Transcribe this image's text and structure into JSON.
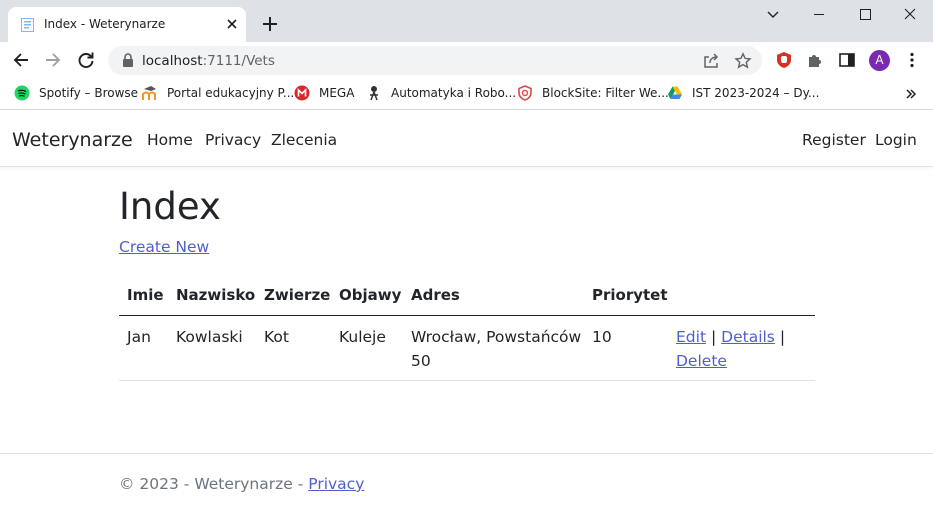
{
  "browser": {
    "tab_title": "Index - Weterynarze",
    "url_host": "localhost",
    "url_path": ":7111/Vets",
    "avatar_letter": "A",
    "bookmarks": [
      {
        "label": "Spotify – Browse",
        "icon": "spotify-icon"
      },
      {
        "label": "Portal edukacyjny P...",
        "icon": "moodle-icon"
      },
      {
        "label": "MEGA",
        "icon": "mega-icon"
      },
      {
        "label": "Automatyka i Robo...",
        "icon": "robot-icon"
      },
      {
        "label": "BlockSite: Filter We...",
        "icon": "shield-icon"
      },
      {
        "label": "IST 2023-2024 – Dy...",
        "icon": "drive-icon"
      }
    ]
  },
  "nav": {
    "brand": "Weterynarze",
    "links": [
      "Home",
      "Privacy",
      "Zlecenia"
    ],
    "register": "Register",
    "login": "Login"
  },
  "page": {
    "title": "Index",
    "create_new": "Create New"
  },
  "table": {
    "headers": [
      "Imie",
      "Nazwisko",
      "Zwierze",
      "Objawy",
      "Adres",
      "Priorytet"
    ],
    "rows": [
      {
        "imie": "Jan",
        "nazwisko": "Kowlaski",
        "zwierze": "Kot",
        "objawy": "Kuleje",
        "adres_line1": "Wrocław, Powstańców",
        "adres_line2": "50",
        "priorytet": "10",
        "edit": "Edit",
        "details": "Details",
        "delete": "Delete",
        "sep": "|"
      }
    ]
  },
  "footer": {
    "text": "© 2023 - Weterynarze - ",
    "privacy": "Privacy"
  },
  "colors": {
    "link": "#4e5fd0",
    "tabstrip": "#dee1e6",
    "avatar": "#7b2ab0"
  }
}
